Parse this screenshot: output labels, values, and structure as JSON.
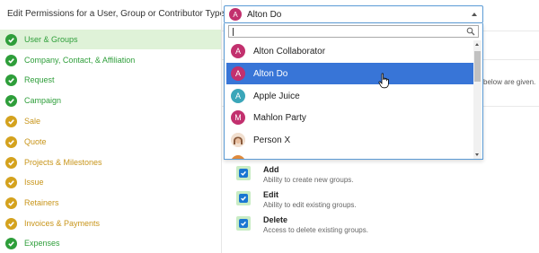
{
  "header": {
    "title": "Edit Permissions for a User, Group or Contributor Type"
  },
  "colors": {
    "green": "#2e9e3a",
    "gold": "#d4a21e",
    "selected_blue": "#3875d7",
    "active_bg": "#dff2d8"
  },
  "sidebar": {
    "items": [
      {
        "label": "User & Groups",
        "status": "green",
        "active": true
      },
      {
        "label": "Company, Contact, & Affiliation",
        "status": "green"
      },
      {
        "label": "Request",
        "status": "green"
      },
      {
        "label": "Campaign",
        "status": "green"
      },
      {
        "label": "Sale",
        "status": "gold"
      },
      {
        "label": "Quote",
        "status": "gold"
      },
      {
        "label": "Projects & Milestones",
        "status": "gold"
      },
      {
        "label": "Issue",
        "status": "gold"
      },
      {
        "label": "Retainers",
        "status": "gold"
      },
      {
        "label": "Invoices & Payments",
        "status": "gold"
      },
      {
        "label": "Expenses",
        "status": "green"
      }
    ]
  },
  "select": {
    "value": "Alton Do",
    "avatar_letter": "A",
    "avatar_color": "#c2306e",
    "search_value": "",
    "options": [
      {
        "label": "Alton Collaborator",
        "letter": "A",
        "color": "#c2306e"
      },
      {
        "label": "Alton Do",
        "letter": "A",
        "color": "#c2306e",
        "selected": true
      },
      {
        "label": "Apple Juice",
        "letter": "A",
        "color": "#3aa6b9"
      },
      {
        "label": "Mahlon Party",
        "letter": "M",
        "color": "#c2306e"
      },
      {
        "label": "Person X",
        "letter": "",
        "color": "#8a5a3c",
        "photo": true
      }
    ]
  },
  "content": {
    "partial_text": "below are given.",
    "permissions": [
      {
        "title": "Add",
        "desc": "Ability to create new groups.",
        "checked": true
      },
      {
        "title": "Edit",
        "desc": "Ability to edit existing groups.",
        "checked": true
      },
      {
        "title": "Delete",
        "desc": "Access to delete existing groups.",
        "checked": true
      }
    ]
  }
}
